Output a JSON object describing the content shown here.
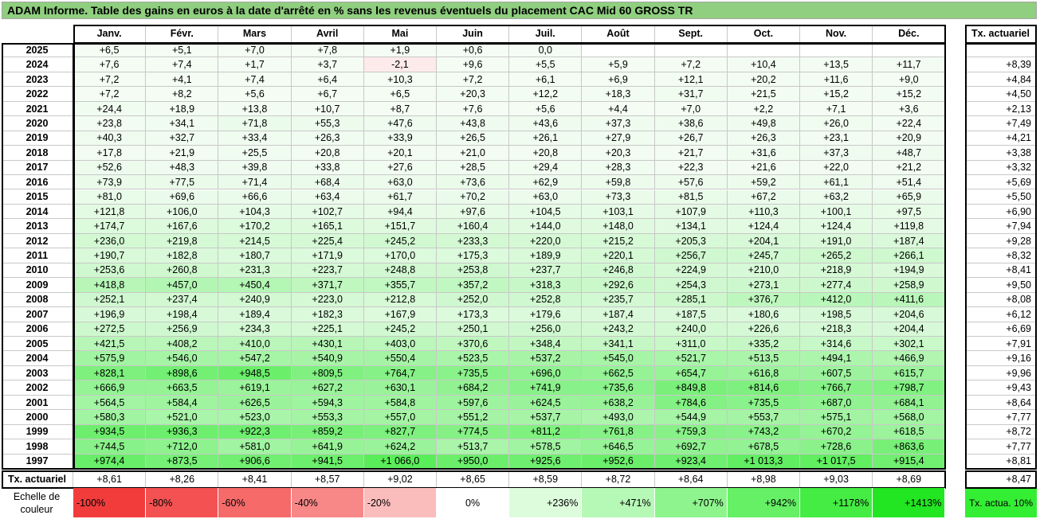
{
  "title": "ADAM Informe. Table des gains en euros à la date d'arrêté en % sans les revenus éventuels du placement CAC Mid 60 GROSS TR",
  "chart_data": {
    "type": "table",
    "columns": [
      "Janv.",
      "Févr.",
      "Mars",
      "Avril",
      "Mai",
      "Juin",
      "Juil.",
      "Août",
      "Sept.",
      "Oct.",
      "Nov.",
      "Déc."
    ],
    "tx_header": "Tx. actuariel",
    "rows": [
      {
        "year": "2025",
        "values": [
          "+6,5",
          "+5,1",
          "+7,0",
          "+7,8",
          "+1,9",
          "+0,6",
          "0,0",
          "",
          "",
          "",
          "",
          ""
        ],
        "nums": [
          6.5,
          5.1,
          7.0,
          7.8,
          1.9,
          0.6,
          0.0,
          null,
          null,
          null,
          null,
          null
        ],
        "tx": ""
      },
      {
        "year": "2024",
        "values": [
          "+7,6",
          "+7,4",
          "+1,7",
          "+3,7",
          "-2,1",
          "+9,6",
          "+5,5",
          "+5,9",
          "+7,2",
          "+10,4",
          "+13,5",
          "+11,7"
        ],
        "nums": [
          7.6,
          7.4,
          1.7,
          3.7,
          -2.1,
          9.6,
          5.5,
          5.9,
          7.2,
          10.4,
          13.5,
          11.7
        ],
        "tx": "+8,39"
      },
      {
        "year": "2023",
        "values": [
          "+7,2",
          "+4,1",
          "+7,4",
          "+6,4",
          "+10,3",
          "+7,2",
          "+6,1",
          "+6,9",
          "+12,1",
          "+20,2",
          "+11,6",
          "+9,0"
        ],
        "nums": [
          7.2,
          4.1,
          7.4,
          6.4,
          10.3,
          7.2,
          6.1,
          6.9,
          12.1,
          20.2,
          11.6,
          9.0
        ],
        "tx": "+4,84"
      },
      {
        "year": "2022",
        "values": [
          "+7,2",
          "+8,2",
          "+5,6",
          "+6,7",
          "+6,5",
          "+20,3",
          "+12,2",
          "+18,3",
          "+31,7",
          "+21,5",
          "+15,2",
          "+15,2"
        ],
        "nums": [
          7.2,
          8.2,
          5.6,
          6.7,
          6.5,
          20.3,
          12.2,
          18.3,
          31.7,
          21.5,
          15.2,
          15.2
        ],
        "tx": "+4,50"
      },
      {
        "year": "2021",
        "values": [
          "+24,4",
          "+18,9",
          "+13,8",
          "+10,7",
          "+8,7",
          "+7,6",
          "+5,6",
          "+4,4",
          "+7,0",
          "+2,2",
          "+7,1",
          "+3,6"
        ],
        "nums": [
          24.4,
          18.9,
          13.8,
          10.7,
          8.7,
          7.6,
          5.6,
          4.4,
          7.0,
          2.2,
          7.1,
          3.6
        ],
        "tx": "+2,13"
      },
      {
        "year": "2020",
        "values": [
          "+23,8",
          "+34,1",
          "+71,8",
          "+55,3",
          "+47,6",
          "+43,8",
          "+43,6",
          "+37,3",
          "+38,6",
          "+49,8",
          "+26,0",
          "+22,4"
        ],
        "nums": [
          23.8,
          34.1,
          71.8,
          55.3,
          47.6,
          43.8,
          43.6,
          37.3,
          38.6,
          49.8,
          26.0,
          22.4
        ],
        "tx": "+7,49"
      },
      {
        "year": "2019",
        "values": [
          "+40,3",
          "+32,7",
          "+33,4",
          "+26,3",
          "+33,9",
          "+26,5",
          "+26,1",
          "+27,9",
          "+26,7",
          "+26,3",
          "+23,1",
          "+20,9"
        ],
        "nums": [
          40.3,
          32.7,
          33.4,
          26.3,
          33.9,
          26.5,
          26.1,
          27.9,
          26.7,
          26.3,
          23.1,
          20.9
        ],
        "tx": "+4,21"
      },
      {
        "year": "2018",
        "values": [
          "+17,8",
          "+21,9",
          "+25,5",
          "+20,8",
          "+20,1",
          "+21,0",
          "+20,8",
          "+20,3",
          "+21,7",
          "+31,6",
          "+37,3",
          "+48,7"
        ],
        "nums": [
          17.8,
          21.9,
          25.5,
          20.8,
          20.1,
          21.0,
          20.8,
          20.3,
          21.7,
          31.6,
          37.3,
          48.7
        ],
        "tx": "+3,38"
      },
      {
        "year": "2017",
        "values": [
          "+52,6",
          "+48,3",
          "+39,8",
          "+33,8",
          "+27,6",
          "+28,5",
          "+29,4",
          "+28,3",
          "+22,3",
          "+21,6",
          "+22,0",
          "+21,2"
        ],
        "nums": [
          52.6,
          48.3,
          39.8,
          33.8,
          27.6,
          28.5,
          29.4,
          28.3,
          22.3,
          21.6,
          22.0,
          21.2
        ],
        "tx": "+3,32"
      },
      {
        "year": "2016",
        "values": [
          "+73,9",
          "+77,5",
          "+71,4",
          "+68,4",
          "+63,0",
          "+73,6",
          "+62,9",
          "+59,8",
          "+57,6",
          "+59,2",
          "+61,1",
          "+51,4"
        ],
        "nums": [
          73.9,
          77.5,
          71.4,
          68.4,
          63.0,
          73.6,
          62.9,
          59.8,
          57.6,
          59.2,
          61.1,
          51.4
        ],
        "tx": "+5,69"
      },
      {
        "year": "2015",
        "values": [
          "+81,0",
          "+69,6",
          "+66,6",
          "+63,4",
          "+61,7",
          "+70,2",
          "+63,0",
          "+73,3",
          "+81,5",
          "+67,2",
          "+63,2",
          "+65,9"
        ],
        "nums": [
          81.0,
          69.6,
          66.6,
          63.4,
          61.7,
          70.2,
          63.0,
          73.3,
          81.5,
          67.2,
          63.2,
          65.9
        ],
        "tx": "+5,50"
      },
      {
        "year": "2014",
        "values": [
          "+121,8",
          "+106,0",
          "+104,3",
          "+102,7",
          "+94,4",
          "+97,6",
          "+104,5",
          "+103,1",
          "+107,9",
          "+110,3",
          "+100,1",
          "+97,5"
        ],
        "nums": [
          121.8,
          106.0,
          104.3,
          102.7,
          94.4,
          97.6,
          104.5,
          103.1,
          107.9,
          110.3,
          100.1,
          97.5
        ],
        "tx": "+6,90"
      },
      {
        "year": "2013",
        "values": [
          "+174,7",
          "+167,6",
          "+170,2",
          "+165,1",
          "+151,7",
          "+160,4",
          "+144,0",
          "+148,0",
          "+134,1",
          "+124,4",
          "+124,4",
          "+119,8"
        ],
        "nums": [
          174.7,
          167.6,
          170.2,
          165.1,
          151.7,
          160.4,
          144.0,
          148.0,
          134.1,
          124.4,
          124.4,
          119.8
        ],
        "tx": "+7,94"
      },
      {
        "year": "2012",
        "values": [
          "+236,0",
          "+219,8",
          "+214,5",
          "+225,4",
          "+245,2",
          "+233,3",
          "+220,0",
          "+215,2",
          "+205,3",
          "+204,1",
          "+191,0",
          "+187,4"
        ],
        "nums": [
          236.0,
          219.8,
          214.5,
          225.4,
          245.2,
          233.3,
          220.0,
          215.2,
          205.3,
          204.1,
          191.0,
          187.4
        ],
        "tx": "+9,28"
      },
      {
        "year": "2011",
        "values": [
          "+190,7",
          "+182,8",
          "+180,7",
          "+171,9",
          "+170,0",
          "+175,3",
          "+189,9",
          "+220,1",
          "+256,7",
          "+245,7",
          "+265,2",
          "+266,1"
        ],
        "nums": [
          190.7,
          182.8,
          180.7,
          171.9,
          170.0,
          175.3,
          189.9,
          220.1,
          256.7,
          245.7,
          265.2,
          266.1
        ],
        "tx": "+8,32"
      },
      {
        "year": "2010",
        "values": [
          "+253,6",
          "+260,8",
          "+231,3",
          "+223,7",
          "+248,8",
          "+253,8",
          "+237,7",
          "+246,8",
          "+224,9",
          "+210,0",
          "+218,9",
          "+194,9"
        ],
        "nums": [
          253.6,
          260.8,
          231.3,
          223.7,
          248.8,
          253.8,
          237.7,
          246.8,
          224.9,
          210.0,
          218.9,
          194.9
        ],
        "tx": "+8,41"
      },
      {
        "year": "2009",
        "values": [
          "+418,8",
          "+457,0",
          "+450,4",
          "+371,7",
          "+355,7",
          "+357,2",
          "+318,3",
          "+292,6",
          "+254,3",
          "+273,1",
          "+277,4",
          "+258,9"
        ],
        "nums": [
          418.8,
          457.0,
          450.4,
          371.7,
          355.7,
          357.2,
          318.3,
          292.6,
          254.3,
          273.1,
          277.4,
          258.9
        ],
        "tx": "+9,50"
      },
      {
        "year": "2008",
        "values": [
          "+252,1",
          "+237,4",
          "+240,9",
          "+223,0",
          "+212,8",
          "+252,0",
          "+252,8",
          "+235,7",
          "+285,1",
          "+376,7",
          "+412,0",
          "+411,6"
        ],
        "nums": [
          252.1,
          237.4,
          240.9,
          223.0,
          212.8,
          252.0,
          252.8,
          235.7,
          285.1,
          376.7,
          412.0,
          411.6
        ],
        "tx": "+8,08"
      },
      {
        "year": "2007",
        "values": [
          "+196,9",
          "+198,4",
          "+189,4",
          "+182,3",
          "+167,9",
          "+173,3",
          "+179,6",
          "+187,4",
          "+187,5",
          "+180,6",
          "+198,5",
          "+204,6"
        ],
        "nums": [
          196.9,
          198.4,
          189.4,
          182.3,
          167.9,
          173.3,
          179.6,
          187.4,
          187.5,
          180.6,
          198.5,
          204.6
        ],
        "tx": "+6,12"
      },
      {
        "year": "2006",
        "values": [
          "+272,5",
          "+256,9",
          "+234,3",
          "+225,1",
          "+245,2",
          "+250,1",
          "+256,0",
          "+243,2",
          "+240,0",
          "+226,6",
          "+218,3",
          "+204,4"
        ],
        "nums": [
          272.5,
          256.9,
          234.3,
          225.1,
          245.2,
          250.1,
          256.0,
          243.2,
          240.0,
          226.6,
          218.3,
          204.4
        ],
        "tx": "+6,69"
      },
      {
        "year": "2005",
        "values": [
          "+421,5",
          "+408,2",
          "+410,0",
          "+430,1",
          "+403,0",
          "+370,6",
          "+348,4",
          "+341,1",
          "+311,0",
          "+335,2",
          "+314,6",
          "+302,1"
        ],
        "nums": [
          421.5,
          408.2,
          410.0,
          430.1,
          403.0,
          370.6,
          348.4,
          341.1,
          311.0,
          335.2,
          314.6,
          302.1
        ],
        "tx": "+7,91"
      },
      {
        "year": "2004",
        "values": [
          "+575,9",
          "+546,0",
          "+547,2",
          "+540,9",
          "+550,4",
          "+523,5",
          "+537,2",
          "+545,0",
          "+521,7",
          "+513,5",
          "+494,1",
          "+466,9"
        ],
        "nums": [
          575.9,
          546.0,
          547.2,
          540.9,
          550.4,
          523.5,
          537.2,
          545.0,
          521.7,
          513.5,
          494.1,
          466.9
        ],
        "tx": "+9,16"
      },
      {
        "year": "2003",
        "values": [
          "+828,1",
          "+898,6",
          "+948,5",
          "+809,5",
          "+764,7",
          "+735,5",
          "+696,0",
          "+662,5",
          "+654,7",
          "+616,8",
          "+607,5",
          "+615,7"
        ],
        "nums": [
          828.1,
          898.6,
          948.5,
          809.5,
          764.7,
          735.5,
          696.0,
          662.5,
          654.7,
          616.8,
          607.5,
          615.7
        ],
        "tx": "+9,96"
      },
      {
        "year": "2002",
        "values": [
          "+666,9",
          "+663,5",
          "+619,1",
          "+627,2",
          "+630,1",
          "+684,2",
          "+741,9",
          "+735,6",
          "+849,8",
          "+814,6",
          "+766,7",
          "+798,7"
        ],
        "nums": [
          666.9,
          663.5,
          619.1,
          627.2,
          630.1,
          684.2,
          741.9,
          735.6,
          849.8,
          814.6,
          766.7,
          798.7
        ],
        "tx": "+9,43"
      },
      {
        "year": "2001",
        "values": [
          "+564,5",
          "+584,4",
          "+626,5",
          "+594,3",
          "+584,8",
          "+597,6",
          "+624,5",
          "+638,2",
          "+784,6",
          "+735,5",
          "+687,0",
          "+684,1"
        ],
        "nums": [
          564.5,
          584.4,
          626.5,
          594.3,
          584.8,
          597.6,
          624.5,
          638.2,
          784.6,
          735.5,
          687.0,
          684.1
        ],
        "tx": "+8,64"
      },
      {
        "year": "2000",
        "values": [
          "+580,3",
          "+521,0",
          "+523,0",
          "+553,3",
          "+557,0",
          "+551,2",
          "+537,7",
          "+493,0",
          "+544,9",
          "+553,7",
          "+575,1",
          "+568,0"
        ],
        "nums": [
          580.3,
          521.0,
          523.0,
          553.3,
          557.0,
          551.2,
          537.7,
          493.0,
          544.9,
          553.7,
          575.1,
          568.0
        ],
        "tx": "+7,77"
      },
      {
        "year": "1999",
        "values": [
          "+934,5",
          "+936,3",
          "+922,3",
          "+859,2",
          "+827,7",
          "+774,5",
          "+811,2",
          "+761,8",
          "+759,3",
          "+743,2",
          "+670,2",
          "+618,5"
        ],
        "nums": [
          934.5,
          936.3,
          922.3,
          859.2,
          827.7,
          774.5,
          811.2,
          761.8,
          759.3,
          743.2,
          670.2,
          618.5
        ],
        "tx": "+8,72"
      },
      {
        "year": "1998",
        "values": [
          "+744,5",
          "+712,0",
          "+581,0",
          "+641,9",
          "+624,2",
          "+513,7",
          "+578,5",
          "+646,5",
          "+692,7",
          "+678,5",
          "+728,6",
          "+863,6"
        ],
        "nums": [
          744.5,
          712.0,
          581.0,
          641.9,
          624.2,
          513.7,
          578.5,
          646.5,
          692.7,
          678.5,
          728.6,
          863.6
        ],
        "tx": "+7,77"
      },
      {
        "year": "1997",
        "values": [
          "+974,4",
          "+873,5",
          "+906,6",
          "+941,5",
          "+1 066,0",
          "+950,0",
          "+925,6",
          "+952,6",
          "+923,4",
          "+1 013,3",
          "+1 017,5",
          "+915,4"
        ],
        "nums": [
          974.4,
          873.5,
          906.6,
          941.5,
          1066.0,
          950.0,
          925.6,
          952.6,
          923.4,
          1013.3,
          1017.5,
          915.4
        ],
        "tx": "+8,81"
      }
    ],
    "footer": {
      "label": "Tx. actuariel",
      "values": [
        "+8,61",
        "+8,26",
        "+8,41",
        "+8,57",
        "+9,02",
        "+8,65",
        "+8,59",
        "+8,72",
        "+8,64",
        "+8,98",
        "+9,03",
        "+8,69"
      ],
      "total": "+8,47"
    }
  },
  "scale": {
    "label": "Echelle de couleur",
    "items": [
      {
        "text": "-100%",
        "color": "#f23c3c",
        "align": "left"
      },
      {
        "text": "-80%",
        "color": "#f45252",
        "align": "left"
      },
      {
        "text": "-60%",
        "color": "#f66a6a",
        "align": "left"
      },
      {
        "text": "-40%",
        "color": "#f88888",
        "align": "left"
      },
      {
        "text": "-20%",
        "color": "#fbbcbc",
        "align": "left"
      },
      {
        "text": "0%",
        "color": "#ffffff",
        "align": "center"
      },
      {
        "text": "+236%",
        "color": "#dcfcdc",
        "align": "right"
      },
      {
        "text": "+471%",
        "color": "#b6f8b6",
        "align": "right"
      },
      {
        "text": "+707%",
        "color": "#8ef48e",
        "align": "right"
      },
      {
        "text": "+942%",
        "color": "#66f066",
        "align": "right"
      },
      {
        "text": "+1178%",
        "color": "#44ec44",
        "align": "right"
      },
      {
        "text": "+1413%",
        "color": "#22e622",
        "align": "right"
      }
    ],
    "badge": "Tx. actua. 10%",
    "badge_color": "#33ee33"
  }
}
